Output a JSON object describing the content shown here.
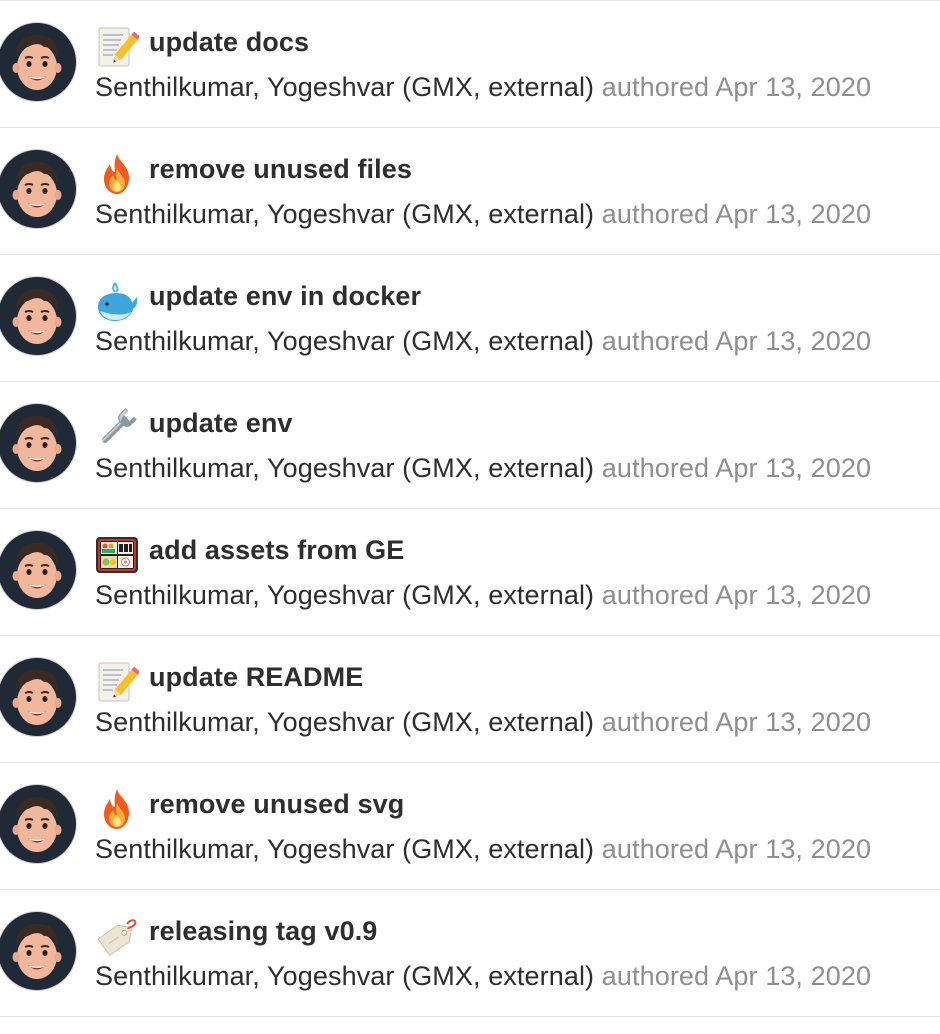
{
  "commits": [
    {
      "emoji": "memo-icon",
      "title": "update docs",
      "author": "Senthilkumar, Yogeshvar (GMX, external)",
      "authored_label": "authored",
      "date": "Apr 13, 2020"
    },
    {
      "emoji": "fire-icon",
      "title": "remove unused files",
      "author": "Senthilkumar, Yogeshvar (GMX, external)",
      "authored_label": "authored",
      "date": "Apr 13, 2020"
    },
    {
      "emoji": "whale-icon",
      "title": "update env in docker",
      "author": "Senthilkumar, Yogeshvar (GMX, external)",
      "authored_label": "authored",
      "date": "Apr 13, 2020"
    },
    {
      "emoji": "wrench-icon",
      "title": "update env",
      "author": "Senthilkumar, Yogeshvar (GMX, external)",
      "authored_label": "authored",
      "date": "Apr 13, 2020"
    },
    {
      "emoji": "bento-icon",
      "title": "add assets from GE",
      "author": "Senthilkumar, Yogeshvar (GMX, external)",
      "authored_label": "authored",
      "date": "Apr 13, 2020"
    },
    {
      "emoji": "memo-icon",
      "title": "update README",
      "author": "Senthilkumar, Yogeshvar (GMX, external)",
      "authored_label": "authored",
      "date": "Apr 13, 2020"
    },
    {
      "emoji": "fire-icon",
      "title": "remove unused svg",
      "author": "Senthilkumar, Yogeshvar (GMX, external)",
      "authored_label": "authored",
      "date": "Apr 13, 2020"
    },
    {
      "emoji": "label-tag-icon",
      "title": "releasing tag v0.9",
      "author": "Senthilkumar, Yogeshvar (GMX, external)",
      "authored_label": "authored",
      "date": "Apr 13, 2020"
    }
  ],
  "colors": {
    "text_primary": "#2e2e2e",
    "text_muted": "#8f8f8f",
    "divider": "#e5e5e5",
    "avatar_bg": "#1f2a36"
  }
}
